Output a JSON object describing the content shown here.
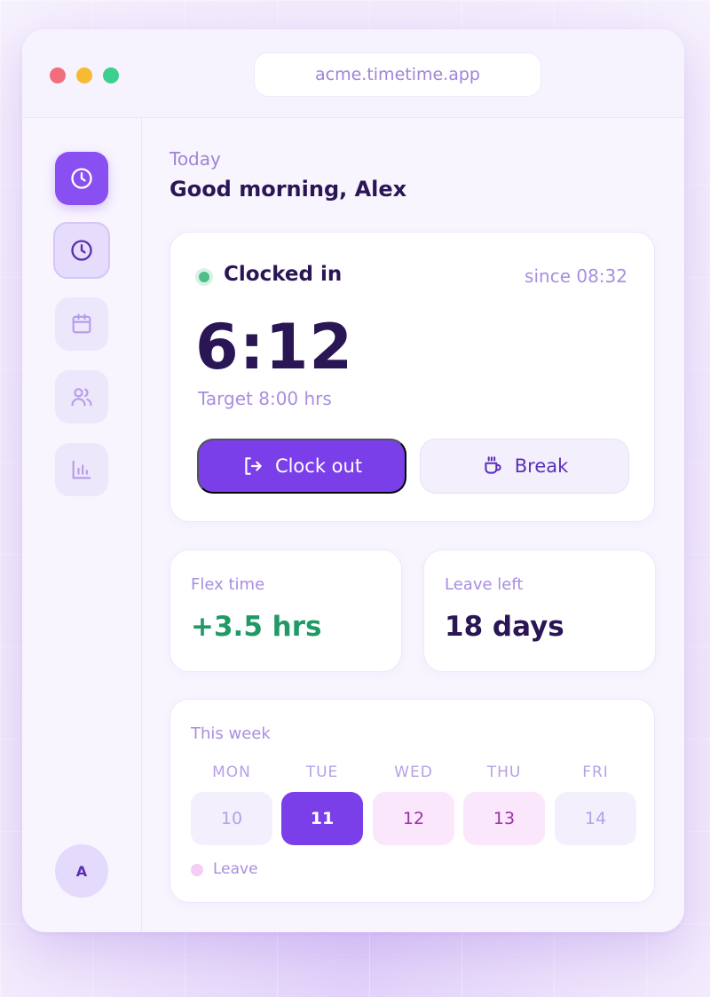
{
  "window": {
    "url": "acme.timetime.app"
  },
  "sidebar": {
    "items": [
      {
        "icon": "clock-icon",
        "name": "logo"
      },
      {
        "icon": "clock-icon",
        "name": "time-tracking",
        "active": true
      },
      {
        "icon": "calendar-icon",
        "name": "calendar"
      },
      {
        "icon": "users-icon",
        "name": "team"
      },
      {
        "icon": "bar-chart-icon",
        "name": "reports"
      }
    ],
    "avatar_initial": "A"
  },
  "header": {
    "eyebrow": "Today",
    "greeting": "Good morning, Alex"
  },
  "clock": {
    "status": "Clocked in",
    "since": "since 08:32",
    "elapsed": "6:12",
    "target": "Target 8:00 hrs",
    "clock_out_label": "Clock out",
    "break_label": "Break"
  },
  "stats": {
    "flex_label": "Flex time",
    "flex_value": "+3.5 hrs",
    "leave_label": "Leave left",
    "leave_value": "18 days"
  },
  "week": {
    "title": "This week",
    "days": [
      {
        "label": "MON",
        "date": "10",
        "state": "normal"
      },
      {
        "label": "TUE",
        "date": "11",
        "state": "today"
      },
      {
        "label": "WED",
        "date": "12",
        "state": "leave"
      },
      {
        "label": "THU",
        "date": "13",
        "state": "leave"
      },
      {
        "label": "FRI",
        "date": "14",
        "state": "normal"
      }
    ],
    "legend_label": "Leave"
  },
  "colors": {
    "accent": "#7a3fe8",
    "positive": "#1f9a66",
    "leave": "#fbe7fb",
    "status_green": "#4fbf8a"
  }
}
